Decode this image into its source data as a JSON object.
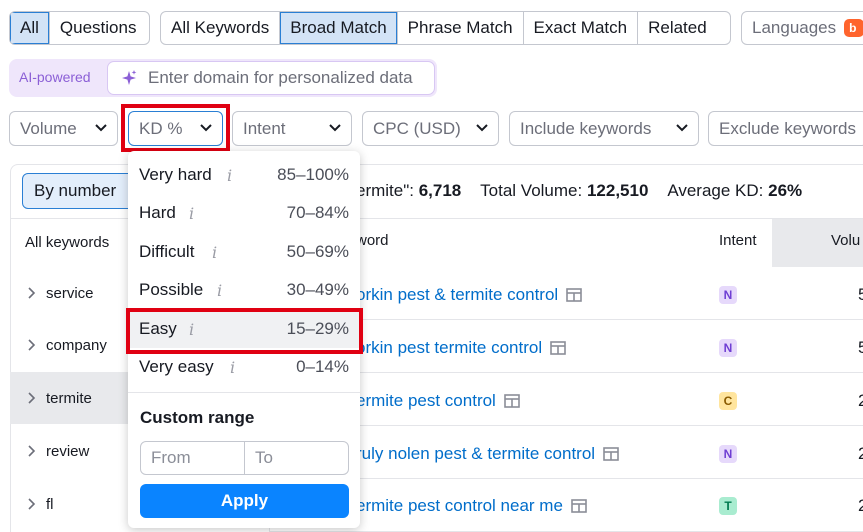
{
  "tabs_group1": [
    "All",
    "Questions"
  ],
  "tabs_group2": [
    "All Keywords",
    "Broad Match",
    "Phrase Match",
    "Exact Match",
    "Related"
  ],
  "languages": {
    "label": "Languages",
    "badge": "b"
  },
  "ai": {
    "label": "AI-powered",
    "placeholder": "Enter domain for personalized data"
  },
  "filters": {
    "volume": "Volume",
    "kd": "KD %",
    "intent": "Intent",
    "cpc": "CPC (USD)",
    "include": "Include keywords",
    "exclude": "Exclude keywords"
  },
  "left": {
    "by_number": "By number",
    "header": "All keywords",
    "items": [
      "service",
      "company",
      "termite",
      "review",
      "fl"
    ]
  },
  "summary": {
    "prefix": "ermite\": ",
    "count": "6,718",
    "total_label": "Total Volume: ",
    "total": "122,510",
    "avg_label": "Average KD: ",
    "avg": "26%"
  },
  "table": {
    "col_keyword": "word",
    "col_intent": "Intent",
    "col_volume": "Volu",
    "rows": [
      {
        "keyword": "orkin pest & termite control",
        "intent": "N",
        "vol": "5"
      },
      {
        "keyword": "orkin pest termite control",
        "intent": "N",
        "vol": "5"
      },
      {
        "keyword": "ermite pest control",
        "intent": "C",
        "vol": "2"
      },
      {
        "keyword": "ruly nolen pest & termite control",
        "intent": "N",
        "vol": "2"
      },
      {
        "keyword": "ermite pest control near me",
        "intent": "T",
        "vol": "2"
      }
    ]
  },
  "kd_dropdown": {
    "options": [
      {
        "label": "Very hard",
        "range": "85–100%"
      },
      {
        "label": "Hard",
        "range": "70–84%"
      },
      {
        "label": "Difficult",
        "range": "50–69%"
      },
      {
        "label": "Possible",
        "range": "30–49%"
      },
      {
        "label": "Easy",
        "range": "15–29%"
      },
      {
        "label": "Very easy",
        "range": "0–14%"
      }
    ],
    "info_glyph": "i",
    "custom_title": "Custom range",
    "from_placeholder": "From",
    "to_placeholder": "To",
    "apply": "Apply"
  },
  "colors": {
    "accent": "#0a84ff",
    "link": "#006dca",
    "highlight_box": "#e00012",
    "ai_purple": "#8b5fd6"
  }
}
